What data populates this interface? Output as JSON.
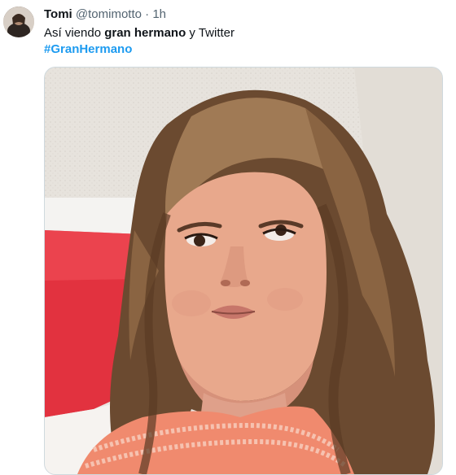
{
  "tweet": {
    "display_name": "Tomi",
    "handle": "@tomimotto",
    "separator": "·",
    "time": "1h",
    "text_parts": {
      "p1": "Así viendo ",
      "bold": "gran hermano",
      "p2": " y Twitter"
    },
    "hashtag": "#GranHermano"
  },
  "icons": {
    "avatar": "avatar",
    "media": "selfie-photo"
  },
  "colors": {
    "link": "#1d9bf0",
    "secondary_text": "#536471",
    "primary_text": "#0f1419"
  }
}
